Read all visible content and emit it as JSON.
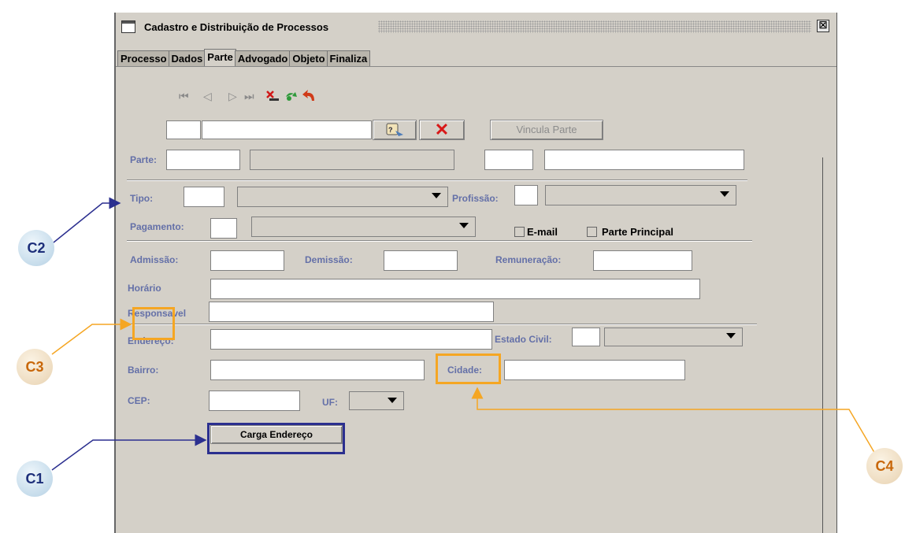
{
  "window": {
    "title": "Cadastro e Distribuição de Processos",
    "close_glyph": "☒",
    "icon": "window-icon"
  },
  "tabs": [
    {
      "label": "Processo",
      "active": false
    },
    {
      "label": "Dados",
      "active": false
    },
    {
      "label": "Parte",
      "active": true
    },
    {
      "label": "Advogado",
      "active": false
    },
    {
      "label": "Objeto",
      "active": false
    },
    {
      "label": "Finaliza",
      "active": false
    }
  ],
  "toolbar": {
    "first": "⏮",
    "prev": "◁",
    "next": "▷",
    "last": "⏭",
    "icons": [
      "first-record-icon",
      "previous-record-icon",
      "next-record-icon",
      "last-record-icon",
      "delete-record-icon",
      "refresh-icon",
      "undo-icon"
    ]
  },
  "search": {
    "code_value": "",
    "name_value": "",
    "vincula_label": "Vincula Parte",
    "clear_glyph": "✕"
  },
  "form": {
    "parte_label": "Parte:",
    "tipo_label": "Tipo:",
    "profissao_label": "Profissão:",
    "pagamento_label": "Pagamento:",
    "email_label": "E-mail",
    "parte_principal_label": "Parte Principal",
    "admissao_label": "Admissão:",
    "demissao_label": "Demissão:",
    "remuneracao_label": "Remuneração:",
    "horario_label": "Horário",
    "responsavel_label": "Responsavel",
    "endereco_label": "Endereço:",
    "estado_civil_label": "Estado Civil:",
    "bairro_label": "Bairro:",
    "cidade_label": "Cidade:",
    "cep_label": "CEP:",
    "uf_label": "UF:",
    "carga_button": "Carga Endereço"
  },
  "callouts": {
    "c1": "C1",
    "c2": "C2",
    "c3": "C3",
    "c4": "C4",
    "blue": "#2b2f8f",
    "orange": "#f5a623"
  }
}
